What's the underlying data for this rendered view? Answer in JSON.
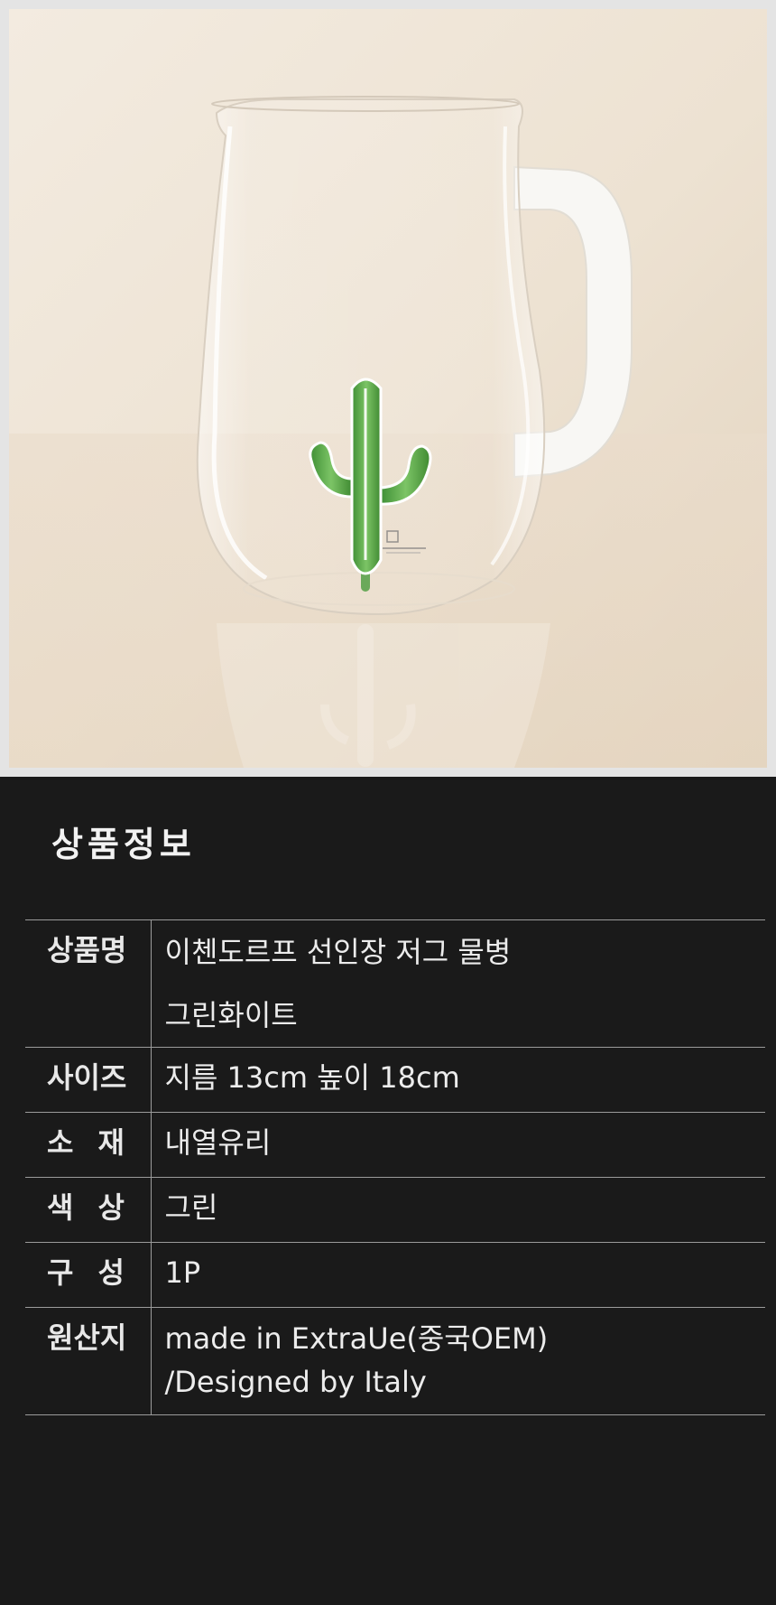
{
  "product_image": {
    "alt": "",
    "colors": {
      "background": "#ede2d3",
      "glass": "#f4f1ec",
      "handle": "#f7f6f3",
      "cactus": "#5aa84a"
    }
  },
  "info": {
    "title": "상품정보",
    "rows": [
      {
        "label": "상품명",
        "value_lines": [
          "이첸도르프 선인장 저그 물병",
          "그린화이트"
        ]
      },
      {
        "label": "사이즈",
        "value_lines": [
          "지름 13cm 높이 18cm"
        ]
      },
      {
        "label": "소재",
        "value_lines": [
          "내열유리"
        ]
      },
      {
        "label": "색상",
        "value_lines": [
          "그린"
        ]
      },
      {
        "label": "구성",
        "value_lines": [
          "1P"
        ]
      },
      {
        "label": "원산지",
        "value_lines": [
          "made in ExtraUe(중국OEM)",
          "/Designed by Italy"
        ]
      }
    ]
  }
}
